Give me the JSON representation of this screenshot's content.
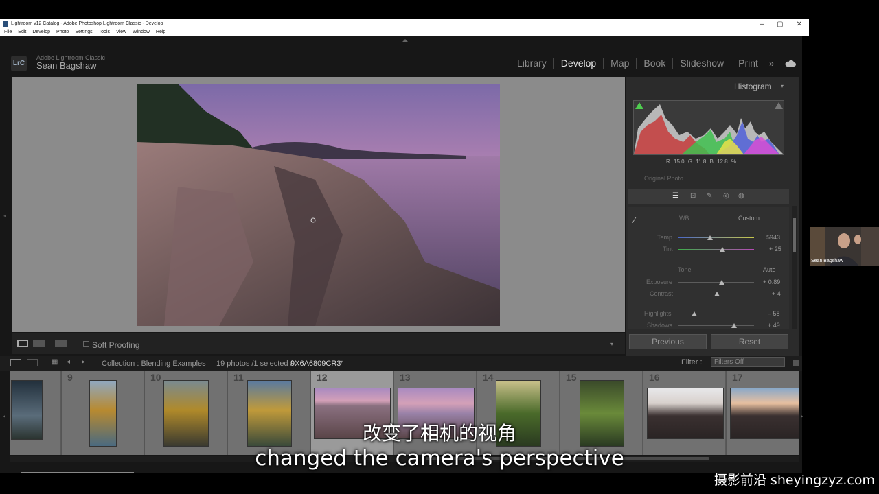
{
  "window": {
    "title": "Lightroom v12 Catalog - Adobe Photoshop Lightroom Classic - Develop",
    "menu": [
      "File",
      "Edit",
      "Develop",
      "Photo",
      "Settings",
      "Tools",
      "View",
      "Window",
      "Help"
    ],
    "controls": [
      "–",
      "▢",
      "✕"
    ]
  },
  "identity": {
    "logo": "LrC",
    "subtitle": "Adobe Lightroom Classic",
    "name": "Sean Bagshaw"
  },
  "modules": {
    "items": [
      "Library",
      "Develop",
      "Map",
      "Book",
      "Slideshow",
      "Print"
    ],
    "active": "Develop",
    "more": "»",
    "cloud_icon": "cloud-sync-icon"
  },
  "toolbar": {
    "soft_proofing": "Soft Proofing"
  },
  "histogram": {
    "title": "Histogram",
    "r_label": "R",
    "r_value": "15.0",
    "g_label": "G",
    "g_value": "11.8",
    "b_label": "B",
    "b_value": "12.8",
    "pct": "%",
    "original_photo": "Original Photo"
  },
  "basic": {
    "wb_label": "WB :",
    "wb_value": "Custom",
    "temp_label": "Temp",
    "temp_value": "5943",
    "temp_pos": 0.42,
    "tint_label": "Tint",
    "tint_value": "+ 25",
    "tint_pos": 0.58,
    "tone_label": "Tone",
    "auto_label": "Auto",
    "exposure_label": "Exposure",
    "exposure_value": "+ 0.89",
    "exposure_pos": 0.57,
    "contrast_label": "Contrast",
    "contrast_value": "+ 4",
    "contrast_pos": 0.51,
    "highlights_label": "Highlights",
    "highlights_value": "– 58",
    "highlights_pos": 0.21,
    "shadows_label": "Shadows",
    "shadows_value": "+ 49",
    "shadows_pos": 0.74
  },
  "buttons": {
    "previous": "Previous",
    "reset": "Reset"
  },
  "filmstrip": {
    "collection": "Collection : Blending Examples",
    "count": "19 photos /1 selected /",
    "file": "9X6A6809CR3",
    "filter_label": "Filter :",
    "filter_value": "Filters Off",
    "numbers": [
      "9",
      "10",
      "11",
      "12",
      "13",
      "14",
      "15",
      "16",
      "17"
    ]
  },
  "webcam": {
    "name": "Sean Bagshaw"
  },
  "subtitles": {
    "zh": "改变了相机的视角",
    "en": "changed the camera's perspective"
  },
  "watermark": "摄影前沿 sheyingzyz.com"
}
